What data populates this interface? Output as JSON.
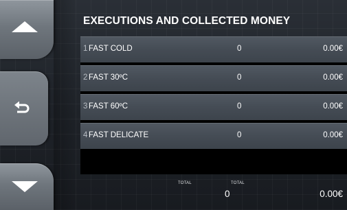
{
  "title": "EXECUTIONS AND COLLECTED MONEY",
  "nav": {
    "up_icon": "triangle-up-icon",
    "back_icon": "return-arrow-icon",
    "down_icon": "triangle-down-icon"
  },
  "rows": [
    {
      "index": "1",
      "name": "FAST COLD",
      "count": "0",
      "money": "0.00€"
    },
    {
      "index": "2",
      "name": "FAST 30ºC",
      "count": "0",
      "money": "0.00€"
    },
    {
      "index": "3",
      "name": "FAST 60ºC",
      "count": "0",
      "money": "0.00€"
    },
    {
      "index": "4",
      "name": "FAST DELICATE",
      "count": "0",
      "money": "0.00€"
    }
  ],
  "totals": {
    "label_left": "TOTAL",
    "label_right": "TOTAL",
    "count": "0",
    "money": "0.00€"
  }
}
